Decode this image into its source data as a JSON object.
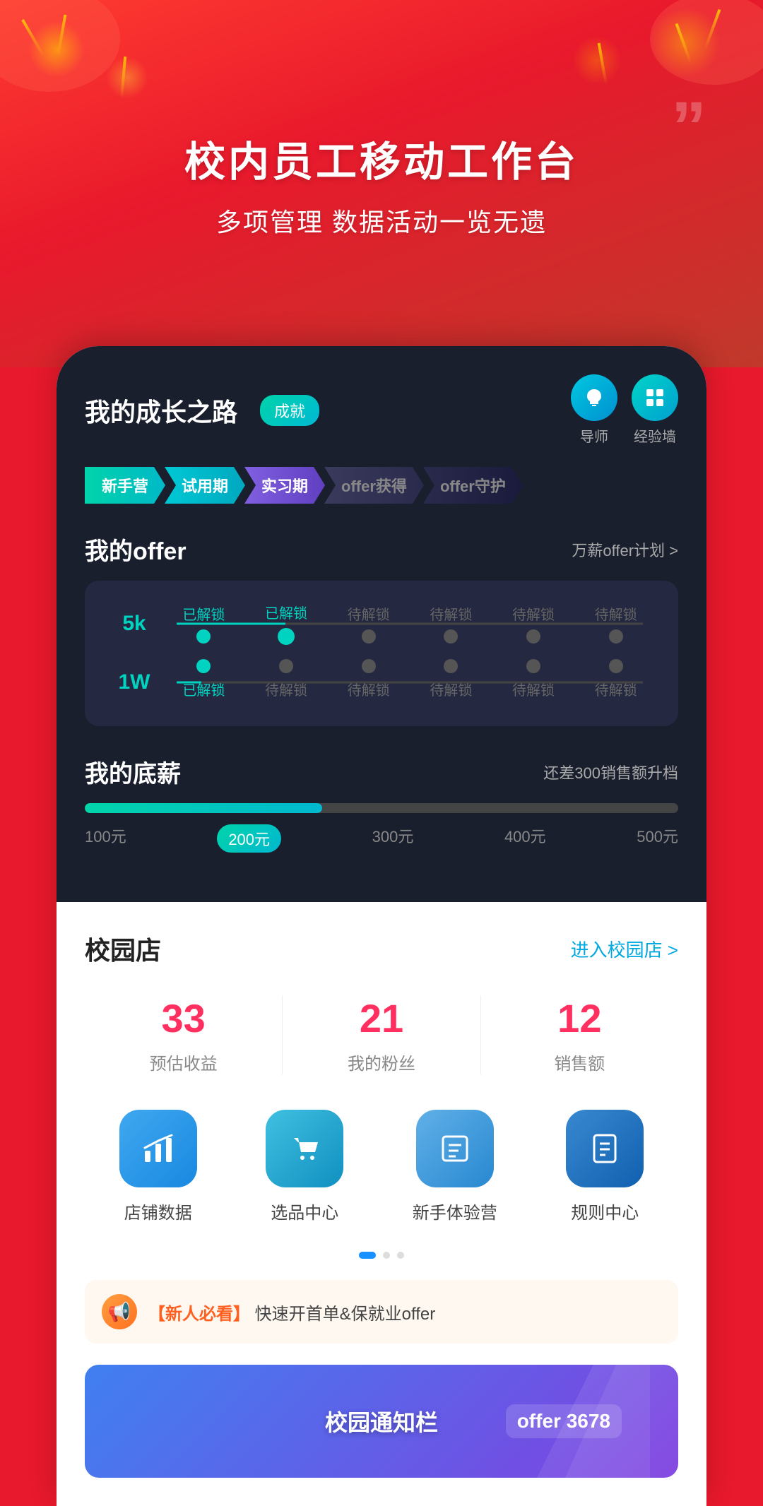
{
  "hero": {
    "title": "校内员工移动工作台",
    "subtitle": "多项管理  数据活动一览无遗",
    "quote_mark": "”"
  },
  "growth": {
    "section_title": "我的成长之路",
    "badge": "成就",
    "mentor_label": "导师",
    "experience_label": "经验墙",
    "steps": [
      {
        "label": "新手营",
        "style": "green"
      },
      {
        "label": "试用期",
        "style": "teal"
      },
      {
        "label": "实习期",
        "style": "purple"
      },
      {
        "label": "offer获得",
        "style": "dark"
      },
      {
        "label": "offer守护",
        "style": "darker"
      }
    ],
    "offer_section": {
      "title": "我的offer",
      "plan_link": "万薪offer计划 >",
      "rows": [
        {
          "amount": "5k",
          "nodes": [
            {
              "label": "已解锁",
              "status": "unlocked"
            },
            {
              "label": "已解锁",
              "status": "unlocked"
            },
            {
              "label": "待解锁",
              "status": "locked"
            },
            {
              "label": "待解锁",
              "status": "locked"
            },
            {
              "label": "待解锁",
              "status": "locked"
            },
            {
              "label": "待解锁",
              "status": "locked"
            }
          ]
        },
        {
          "amount": "1W",
          "nodes": [
            {
              "label": "已解锁",
              "status": "unlocked"
            },
            {
              "label": "待解锁",
              "status": "locked"
            },
            {
              "label": "待解锁",
              "status": "locked"
            },
            {
              "label": "待解锁",
              "status": "locked"
            },
            {
              "label": "待解锁",
              "status": "locked"
            },
            {
              "label": "待解锁",
              "status": "locked"
            }
          ]
        }
      ]
    },
    "salary_section": {
      "title": "我的底薪",
      "hint": "还差300销售额升档",
      "progress_percent": 40,
      "labels": [
        "100元",
        "200元",
        "300元",
        "400元",
        "500元"
      ],
      "active_label_index": 1
    }
  },
  "campus": {
    "title": "校园店",
    "link": "进入校园店 >",
    "stats": [
      {
        "value": "33",
        "label": "预估收益"
      },
      {
        "value": "21",
        "label": "我的粉丝"
      },
      {
        "value": "12",
        "label": "销售额"
      }
    ],
    "menu_items": [
      {
        "label": "店铺数据",
        "icon": "📊",
        "style": "blue"
      },
      {
        "label": "选品中心",
        "icon": "🛍",
        "style": "teal"
      },
      {
        "label": "新手体验营",
        "icon": "📋",
        "style": "violet"
      },
      {
        "label": "规则中心",
        "icon": "📄",
        "style": "navy"
      }
    ]
  },
  "notice": {
    "text_prefix": "【新人必看】",
    "text_main": "快速开首单&保就业offer"
  },
  "promo": {
    "text": "校园通知栏",
    "offer_badge": "offer 3678"
  }
}
